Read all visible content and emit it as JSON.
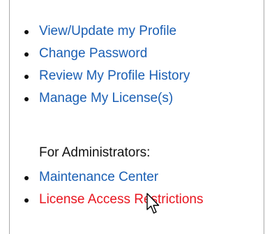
{
  "menu": {
    "items": [
      {
        "label": "View/Update my Profile"
      },
      {
        "label": "Change Password"
      },
      {
        "label": "Review My Profile History"
      },
      {
        "label": "Manage My License(s)"
      }
    ]
  },
  "admin": {
    "heading": "For Administrators:",
    "items": [
      {
        "label": "Maintenance Center"
      },
      {
        "label": "License Access Restrictions",
        "state": "hover"
      }
    ]
  },
  "colors": {
    "link": "#1a5fb4",
    "link_hover": "#e8141e",
    "text": "#111111",
    "border": "#a9a9a9"
  },
  "icons": {
    "pointer": "arrow-cursor-icon"
  }
}
